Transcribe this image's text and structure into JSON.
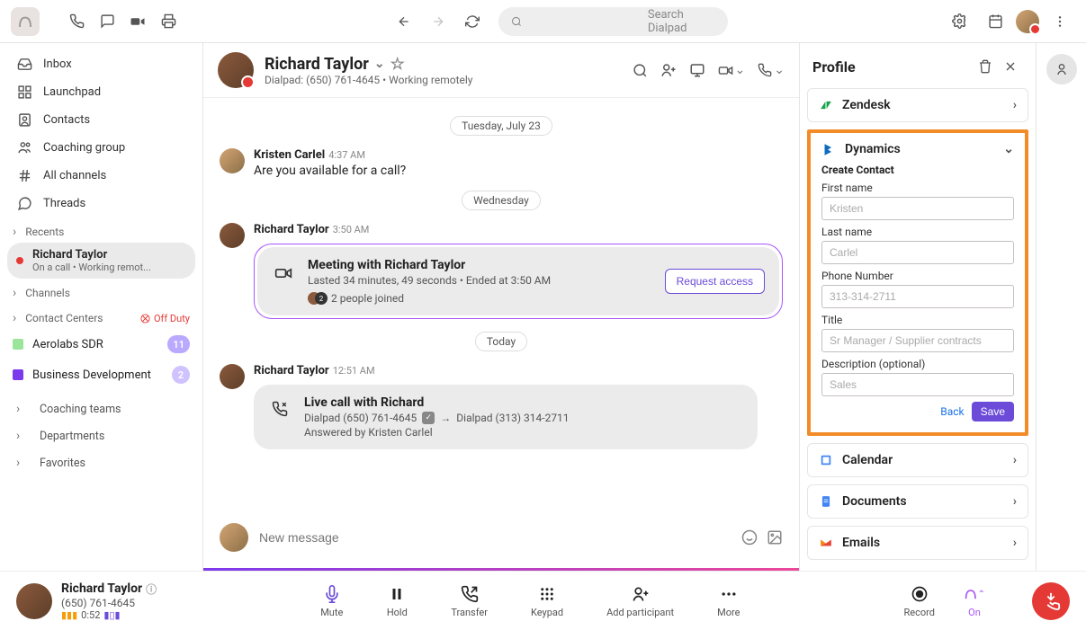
{
  "topbar": {
    "search_placeholder": "Search Dialpad"
  },
  "sidebar": {
    "nav": [
      {
        "label": "Inbox"
      },
      {
        "label": "Launchpad"
      },
      {
        "label": "Contacts"
      },
      {
        "label": "Coaching group"
      },
      {
        "label": "All channels"
      },
      {
        "label": "Threads"
      }
    ],
    "recents_label": "Recents",
    "recent": {
      "name": "Richard Taylor",
      "sub": "On a call • Working remot..."
    },
    "channels_label": "Channels",
    "contact_centers_label": "Contact Centers",
    "off_duty": "Off Duty",
    "channels": [
      {
        "label": "Aerolabs SDR",
        "badge": "11",
        "color": "#9be59b"
      },
      {
        "label": "Business Development",
        "badge": "2",
        "color": "#7c3aed"
      }
    ],
    "more": [
      {
        "label": "Coaching teams"
      },
      {
        "label": "Departments"
      },
      {
        "label": "Favorites"
      }
    ]
  },
  "conversation": {
    "name": "Richard Taylor",
    "sub": "Dialpad: (650) 761-4645 • Working remotely",
    "dates": {
      "d1": "Tuesday, July 23",
      "d2": "Wednesday",
      "d3": "Today"
    },
    "msg1": {
      "name": "Kristen Carlel",
      "time": "4:37 AM",
      "text": "Are you available for a call?"
    },
    "msg2": {
      "name": "Richard Taylor",
      "time": "3:50 AM"
    },
    "meeting": {
      "title": "Meeting with Richard Taylor",
      "sub": "Lasted 34 minutes, 49 seconds • Ended at 3:50 AM",
      "people": "2 people joined",
      "request": "Request access"
    },
    "msg3": {
      "name": "Richard Taylor",
      "time": "12:51 AM"
    },
    "call": {
      "title": "Live call with Richard",
      "line1a": "Dialpad (650) 761-4645",
      "line1b": "Dialpad (313) 314-2711",
      "line2": "Answered by Kristen Carlel"
    },
    "composer_placeholder": "New message"
  },
  "profile": {
    "title": "Profile",
    "zendesk": "Zendesk",
    "dynamics": "Dynamics",
    "create_contact": "Create Contact",
    "fields": {
      "first_name_label": "First name",
      "first_name_ph": "Kristen",
      "last_name_label": "Last name",
      "last_name_ph": "Carlel",
      "phone_label": "Phone Number",
      "phone_ph": "313-314-2711",
      "title_label": "Title",
      "title_ph": "Sr Manager / Supplier contracts",
      "desc_label": "Description (optional)",
      "desc_ph": "Sales"
    },
    "back": "Back",
    "save": "Save",
    "calendar": "Calendar",
    "documents": "Documents",
    "emails": "Emails"
  },
  "callbar": {
    "name": "Richard Taylor",
    "phone": "(650) 761-4645",
    "timer": "0:52",
    "controls": {
      "mute": "Mute",
      "hold": "Hold",
      "transfer": "Transfer",
      "keypad": "Keypad",
      "add": "Add participant",
      "more": "More",
      "record": "Record",
      "on": "On"
    }
  }
}
